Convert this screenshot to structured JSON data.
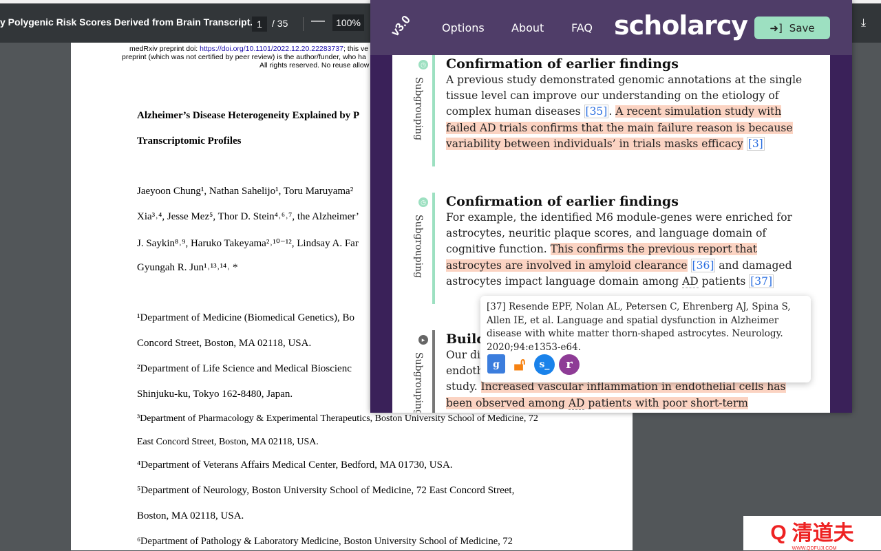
{
  "viewer": {
    "title": "y Polygenic Risk Scores Derived from Brain Transcript...",
    "page": "1",
    "total": "/ 35",
    "zoom": "100%",
    "minus": "—",
    "download": "⤓"
  },
  "pdf": {
    "header1": "medRxiv preprint doi: ",
    "doi": "https://doi.org/10.1101/2022.12.20.22283737",
    "header1b": "; this ve",
    "header2": "preprint (which was not certified by peer review) is the author/funder, who ha",
    "header3": "All rights reserved. No reuse allow",
    "title1": "Alzheimer’s Disease Heterogeneity Explained by P",
    "title2": "Transcriptomic Profiles",
    "authors": [
      "Jaeyoon Chung¹, Nathan Sahelijo¹, Toru Maruyama²",
      "Xia³˒⁴, Jesse Mez⁵, Thor D. Stein⁴˒⁶˒⁷, the Alzheimer’",
      "J. Saykin⁸˒⁹, Haruko Takeyama²˒¹⁰⁻¹², Lindsay A. Far",
      "Gyungah R. Jun¹˒¹³˒¹⁴˒ *"
    ],
    "affiliations": [
      "¹Department of Medicine (Biomedical Genetics), Bo",
      "Concord Street, Boston, MA 02118, USA.",
      "²Department of Life Science and Medical Bioscienc",
      "Shinjuku-ku, Tokyo 162-8480, Japan.",
      "³Department of Pharmacology & Experimental Therapeutics, Boston University School of Medicine, 72",
      "East Concord Street, Boston, MA 02118, USA.",
      "⁴Department of Veterans Affairs Medical Center, Bedford, MA 01730, USA.",
      "⁵Department of Neurology, Boston University School of Medicine, 72 East Concord Street,",
      "Boston, MA 02118, USA.",
      "⁶Department of Pathology & Laboratory Medicine, Boston University School of Medicine, 72"
    ]
  },
  "scholarcy": {
    "version": "v3.0",
    "nav": [
      "Options",
      "About",
      "FAQ"
    ],
    "logo": "scholarcy",
    "save": "Save",
    "sections": [
      {
        "label": "Subgrouping",
        "heading": "Confirmation of earlier findings",
        "t1": "A previous study demonstrated genomic annotations at the single tissue level can improve our understanding on the etiology of complex human diseases ",
        "r1": "[35]",
        "t2": ". ",
        "hl": "A recent simulation study with failed AD trials confirms that the main failure reason is because variability between individuals’ in trials masks efficacy",
        "r2": "[3]"
      },
      {
        "label": "Subgrouping",
        "heading": "Confirmation of earlier findings",
        "t1": "For example, the identified M6 module-genes were enriched for astrocytes, neuritic plaque scores, and language domain of cognitive function. ",
        "hl": "This confirms the previous report that astrocytes are involved in amyloid clearance",
        "r1": "[36]",
        "t2": " and damaged astrocytes impact language domain among ",
        "ab": "AD",
        "t3": " patients ",
        "r2": "[37]"
      },
      {
        "label": "Subgrouping",
        "heading": "Build",
        "t1": "Our dis",
        "t2": "endoth",
        "t3": "study. ",
        "hl": "Increased vascular inflammation in endothelial cells has been observed among ",
        "ab": "AD",
        "hl2": " patients with poor short-term visuospatial"
      }
    ],
    "popup": "[37] Resende EPF, Nolan AL, Petersen C, Ehrenberg AJ, Spina S, Allen IE, et al. Language and spatial dysfunction in Alzheimer disease with white matter thorn-shaped astrocytes. Neurology. 2020;94:e1353-e64.",
    "colors": {
      "header": "#4f3d68",
      "accent": "#9de0c1",
      "highlight": "#fbd3c2"
    }
  },
  "watermark": {
    "text": "清道夫",
    "sub": "WWW.QDFUJI.COM"
  }
}
